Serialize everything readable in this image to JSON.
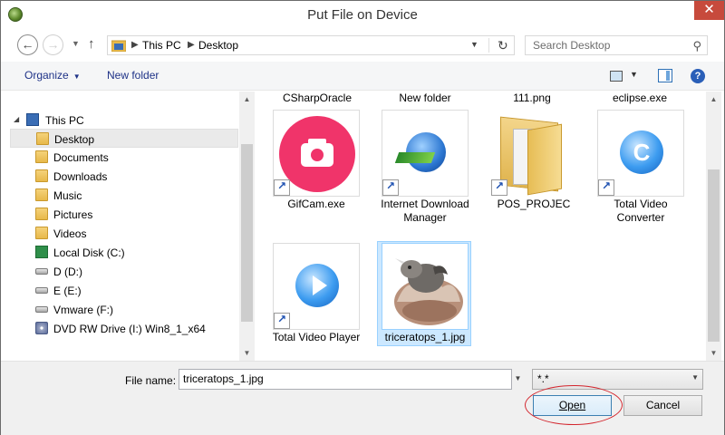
{
  "window": {
    "title": "Put File on Device",
    "close_glyph": "✕"
  },
  "nav": {
    "back_glyph": "←",
    "forward_glyph": "→",
    "up_glyph": "↑",
    "breadcrumb": [
      "This PC",
      "Desktop"
    ],
    "search_placeholder": "Search Desktop"
  },
  "toolbar": {
    "organize_label": "Organize",
    "new_folder_label": "New folder",
    "help_label": "?"
  },
  "sidebar": {
    "root": "This PC",
    "items": [
      {
        "label": "Desktop",
        "icon": "folder-icon",
        "selected": true
      },
      {
        "label": "Documents",
        "icon": "folder-icon"
      },
      {
        "label": "Downloads",
        "icon": "folder-icon"
      },
      {
        "label": "Music",
        "icon": "folder-icon"
      },
      {
        "label": "Pictures",
        "icon": "folder-icon"
      },
      {
        "label": "Videos",
        "icon": "folder-icon"
      },
      {
        "label": "Local Disk (C:)",
        "icon": "windows-drive-icon"
      },
      {
        "label": "D (D:)",
        "icon": "drive-icon"
      },
      {
        "label": "E (E:)",
        "icon": "drive-icon"
      },
      {
        "label": "Vmware (F:)",
        "icon": "drive-icon"
      },
      {
        "label": "DVD RW Drive (I:) Win8_1_x64",
        "icon": "dvd-icon"
      }
    ]
  },
  "files": {
    "partial_row": [
      "CSharpOracle",
      "New folder",
      "111.png",
      "eclipse.exe"
    ],
    "row1": [
      {
        "label": "GifCam.exe",
        "icon": "gifcam-icon",
        "shortcut": true
      },
      {
        "label": "Internet Download Manager",
        "icon": "idm-icon",
        "shortcut": true
      },
      {
        "label": "POS_PROJEC",
        "icon": "folder-icon",
        "shortcut": true
      },
      {
        "label": "Total Video Converter",
        "icon": "converter-icon",
        "shortcut": true
      }
    ],
    "row2": [
      {
        "label": "Total Video Player",
        "icon": "player-icon",
        "shortcut": true
      },
      {
        "label": "triceratops_1.jpg",
        "icon": "image-thumbnail",
        "selected": true
      }
    ]
  },
  "footer": {
    "file_name_label": "File name:",
    "file_name_value": "triceratops_1.jpg",
    "filter_value": "*.*",
    "open_label": "Open",
    "cancel_label": "Cancel"
  },
  "colors": {
    "close": "#c74a3c",
    "selection": "#cce8ff",
    "link": "#1e3287",
    "highlight": "#d3262e"
  }
}
